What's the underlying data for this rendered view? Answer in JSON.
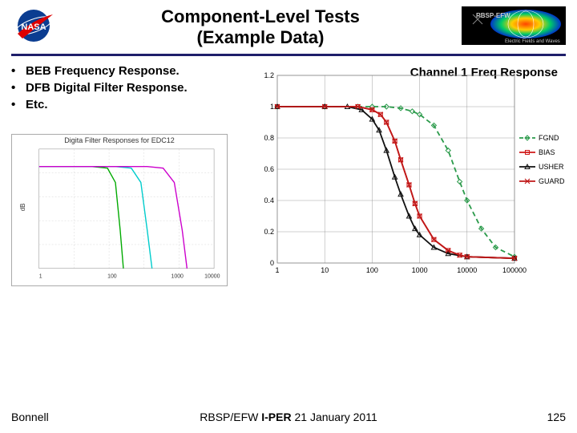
{
  "title_line1": "Component-Level Tests",
  "title_line2": "(Example Data)",
  "bullets": [
    "BEB Frequency Response.",
    "DFB Digital Filter Response.",
    "Etc."
  ],
  "mini_chart_title": "Digita Filter Responses for EDC12",
  "footer": {
    "left": "Bonnell",
    "center": "RBSP/EFW I-PER 21 January 2011",
    "right": "125"
  },
  "chart_data": {
    "type": "line",
    "title": "Channel 1 Freq Response",
    "xscale": "log",
    "xlabel": "",
    "ylabel": "",
    "ylim": [
      0,
      1.2
    ],
    "yticks": [
      0,
      0.2,
      0.4,
      0.6,
      0.8,
      1,
      1.2
    ],
    "xticks": [
      1,
      10,
      100,
      1000,
      10000,
      100000
    ],
    "series": [
      {
        "name": "FGND",
        "color": "#2a9a4a",
        "dash": true,
        "marker": "diamond",
        "x": [
          1,
          10,
          50,
          100,
          200,
          400,
          700,
          1000,
          2000,
          4000,
          7000,
          10000,
          20000,
          40000,
          100000
        ],
        "y": [
          1.0,
          1.0,
          1.0,
          1.0,
          1.0,
          0.99,
          0.97,
          0.95,
          0.88,
          0.72,
          0.52,
          0.4,
          0.22,
          0.1,
          0.04
        ]
      },
      {
        "name": "BIAS",
        "color": "#d01818",
        "dash": false,
        "marker": "square",
        "x": [
          1,
          10,
          50,
          100,
          150,
          200,
          300,
          400,
          600,
          800,
          1000,
          2000,
          4000,
          7000,
          10000,
          100000
        ],
        "y": [
          1.0,
          1.0,
          1.0,
          0.98,
          0.95,
          0.9,
          0.78,
          0.66,
          0.5,
          0.38,
          0.3,
          0.15,
          0.08,
          0.05,
          0.04,
          0.03
        ]
      },
      {
        "name": "USHER",
        "color": "#101010",
        "dash": false,
        "marker": "triangle",
        "x": [
          1,
          10,
          30,
          60,
          100,
          140,
          200,
          300,
          400,
          600,
          800,
          1000,
          2000,
          4000,
          10000,
          100000
        ],
        "y": [
          1.0,
          1.0,
          1.0,
          0.98,
          0.92,
          0.85,
          0.72,
          0.55,
          0.44,
          0.3,
          0.22,
          0.18,
          0.1,
          0.06,
          0.04,
          0.03
        ]
      },
      {
        "name": "GUARD",
        "color": "#c01818",
        "dash": false,
        "marker": "x",
        "x": [
          1,
          10,
          50,
          100,
          150,
          200,
          300,
          400,
          600,
          800,
          1000,
          2000,
          4000,
          7000,
          10000,
          100000
        ],
        "y": [
          1.0,
          1.0,
          1.0,
          0.98,
          0.95,
          0.9,
          0.78,
          0.66,
          0.5,
          0.38,
          0.3,
          0.15,
          0.08,
          0.05,
          0.04,
          0.03
        ]
      }
    ]
  }
}
